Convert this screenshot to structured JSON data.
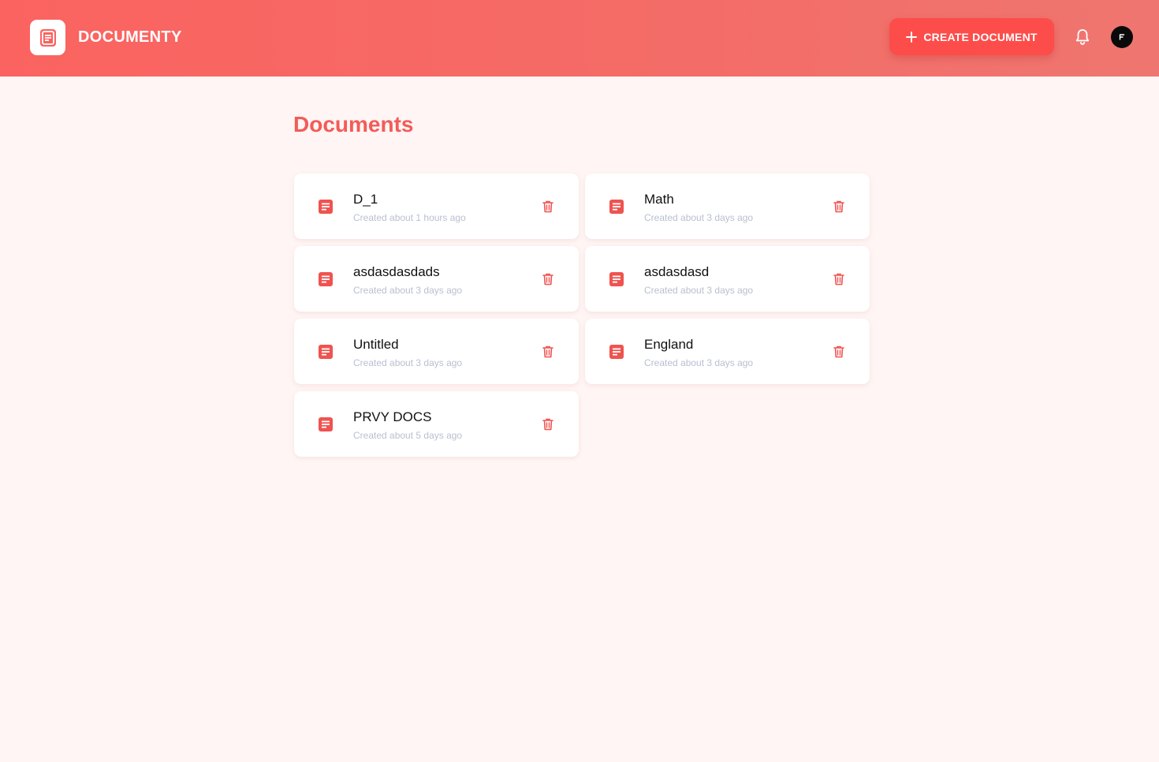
{
  "app": {
    "name": "DOCUMENTY"
  },
  "header": {
    "create_label": "CREATE DOCUMENT",
    "avatar_initial": "F"
  },
  "main": {
    "title": "Documents"
  },
  "documents": [
    {
      "title": "D_1",
      "created": "Created about 1 hours ago"
    },
    {
      "title": "Math",
      "created": "Created about 3 days ago"
    },
    {
      "title": "asdasdasdads",
      "created": "Created about 3 days ago"
    },
    {
      "title": "asdasdasd",
      "created": "Created about 3 days ago"
    },
    {
      "title": "Untitled",
      "created": "Created about 3 days ago"
    },
    {
      "title": "England",
      "created": "Created about 3 days ago"
    },
    {
      "title": "PRVY DOCS",
      "created": "Created about 5 days ago"
    }
  ],
  "colors": {
    "brand": "#fb6360",
    "accent": "#fd4d4a",
    "title": "#f25c58",
    "background": "#fff5f4"
  },
  "icons": {
    "logo": "document-logo-icon",
    "create": "plus-icon",
    "notifications": "bell-icon",
    "document": "document-icon",
    "delete": "trash-icon"
  }
}
